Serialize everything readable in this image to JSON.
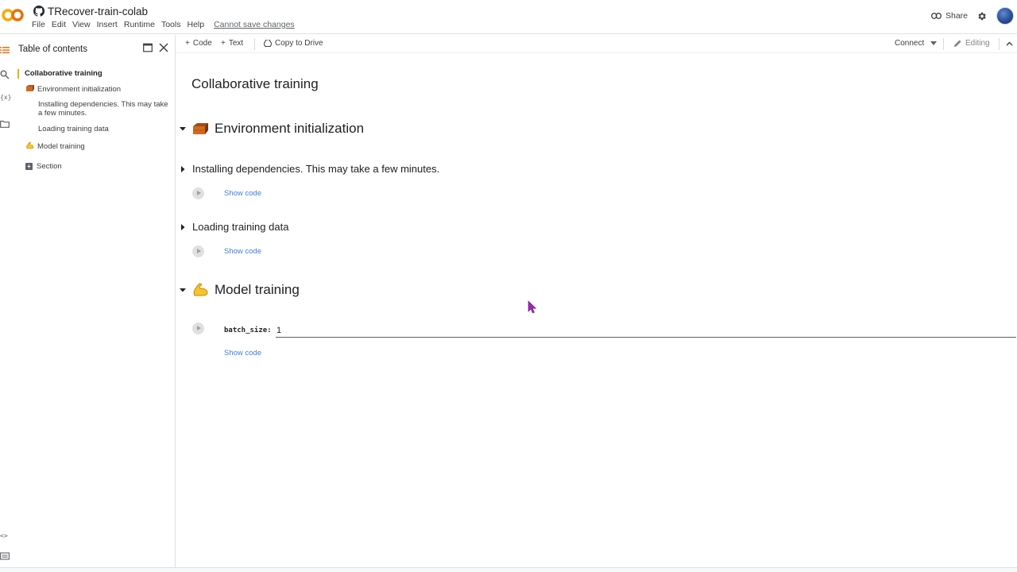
{
  "header": {
    "notebook_title": "TRecover-train-colab",
    "menu": [
      "File",
      "Edit",
      "View",
      "Insert",
      "Runtime",
      "Tools",
      "Help"
    ],
    "save_warning": "Cannot save changes",
    "share_label": "Share"
  },
  "toc": {
    "title": "Table of contents",
    "items": [
      {
        "label": "Collaborative training"
      },
      {
        "label": "Environment initialization"
      },
      {
        "label": "Installing dependencies. This may take a few minutes."
      },
      {
        "label": "Loading training data"
      },
      {
        "label": "Model training"
      },
      {
        "label": "Section"
      }
    ]
  },
  "toolbar": {
    "code_label": "Code",
    "text_label": "Text",
    "copy_label": "Copy to Drive",
    "connect_label": "Connect",
    "editing_label": "Editing"
  },
  "notebook": {
    "heading_main": "Collaborative training",
    "section_env": "Environment initialization",
    "sub_install": "Installing dependencies. This may take a few minutes.",
    "sub_loading": "Loading training data",
    "section_model": "Model training",
    "show_code": "Show code",
    "param_label": "batch_size:",
    "param_value": "1"
  },
  "colors": {
    "accent_orange": "#f9ab00",
    "link_blue": "#1967d2",
    "cursor_purple": "#9c27b0"
  }
}
